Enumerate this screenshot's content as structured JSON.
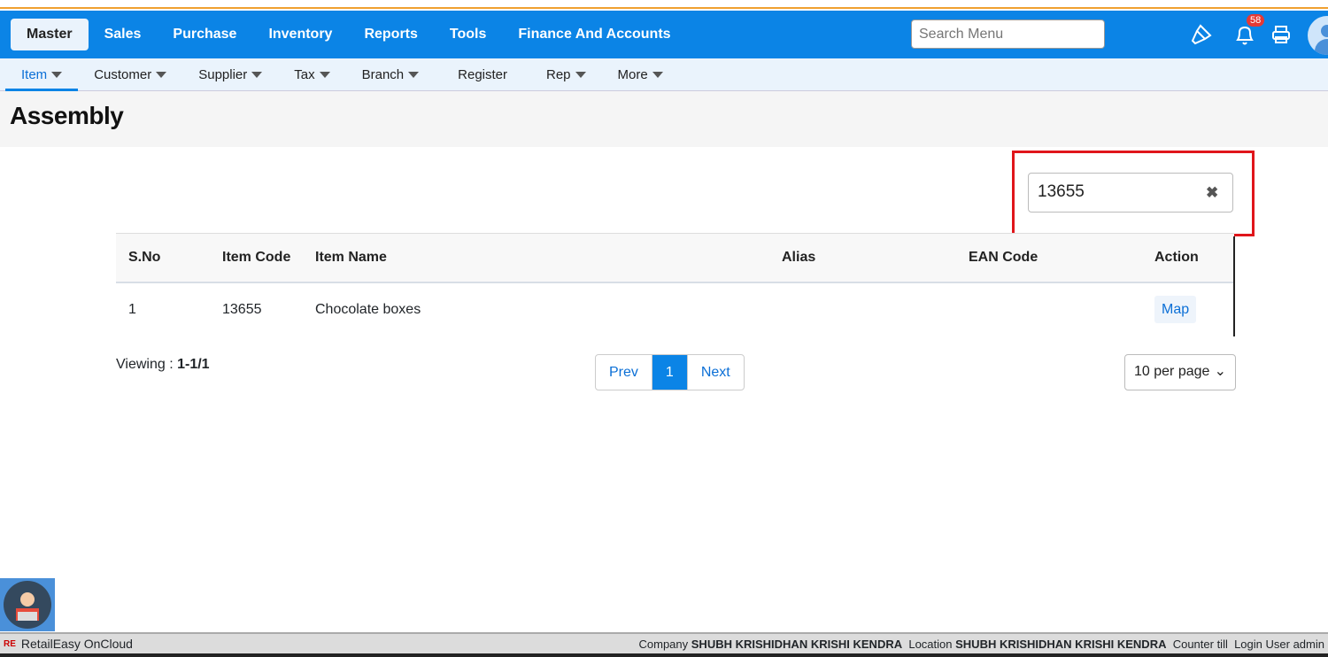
{
  "nav": {
    "items": [
      "Master",
      "Sales",
      "Purchase",
      "Inventory",
      "Reports",
      "Tools",
      "Finance And Accounts"
    ],
    "search_placeholder": "Search Menu",
    "notification_count": "58"
  },
  "subnav": {
    "items": [
      {
        "label": "Item",
        "caret": true
      },
      {
        "label": "Customer",
        "caret": true
      },
      {
        "label": "Supplier",
        "caret": true
      },
      {
        "label": "Tax",
        "caret": true
      },
      {
        "label": "Branch",
        "caret": true
      },
      {
        "label": "Register",
        "caret": false
      },
      {
        "label": "Rep",
        "caret": true
      },
      {
        "label": "More",
        "caret": true
      }
    ]
  },
  "page": {
    "title": "Assembly",
    "filter_value": "13655",
    "clear_icon": "✖"
  },
  "table": {
    "headers": [
      "S.No",
      "Item Code",
      "Item Name",
      "Alias",
      "EAN Code",
      "Action"
    ],
    "rows": [
      {
        "sno": "1",
        "code": "13655",
        "name": "Chocolate boxes",
        "alias": "",
        "ean": "",
        "action": "Map"
      }
    ]
  },
  "pagination": {
    "viewing_label": "Viewing :",
    "viewing_value": "1-1/1",
    "prev": "Prev",
    "current": "1",
    "next": "Next",
    "per_page": "10 per page"
  },
  "status": {
    "app": "RetailEasy OnCloud",
    "company_label": "Company",
    "company": "SHUBH KRISHIDHAN KRISHI KENDRA",
    "location_label": "Location",
    "location": "SHUBH KRISHIDHAN KRISHI KENDRA",
    "counter": "Counter till",
    "login_label": "Login User",
    "login": "admin"
  }
}
